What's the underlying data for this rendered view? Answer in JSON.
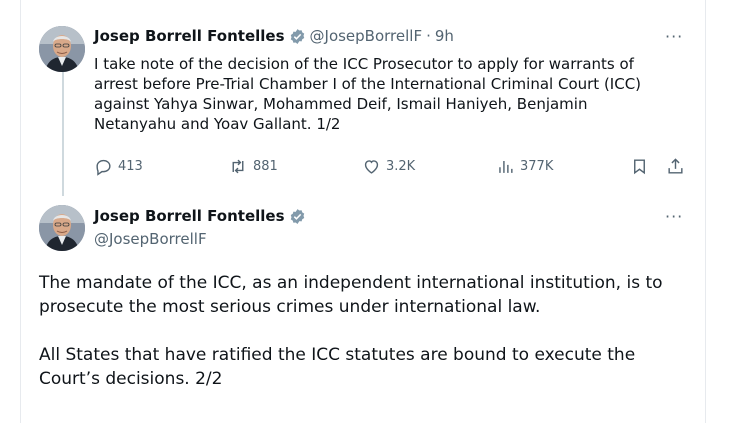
{
  "tweet1": {
    "author_name": "Josep Borrell Fontelles",
    "author_handle": "@JosepBorrellF",
    "separator": "·",
    "time": "9h",
    "text": "I take note of the decision of the ICC Prosecutor to apply  for warrants of\narrest before Pre-Trial Chamber I of the International Criminal Court (ICC)\nagainst Yahya Sinwar, Mohammed Deif, Ismail Haniyeh, Benjamin\nNetanyahu and Yoav Gallant. 1/2",
    "more_label": "···",
    "stats": {
      "replies": "413",
      "reposts": "881",
      "likes": "3.2K",
      "views": "377K"
    }
  },
  "tweet2": {
    "author_name": "Josep Borrell Fontelles",
    "author_handle": "@JosepBorrellF",
    "more_label": "···",
    "paragraphs": [
      "The mandate of the ICC, as an independent international institution, is to prosecute the most serious crimes under international law.",
      "All States that have ratified the ICC statutes are bound to execute the Court’s decisions. 2/2"
    ]
  },
  "icons": {
    "verified": "verified-badge-icon",
    "reply": "reply-icon",
    "repost": "repost-icon",
    "like": "heart-icon",
    "views": "views-icon",
    "bookmark": "bookmark-icon",
    "share": "share-icon",
    "more": "more-icon"
  },
  "colors": {
    "text": "#0f1419",
    "secondary": "#536471",
    "thread_line": "#cfd9de",
    "verified_badge": "#829aab"
  }
}
